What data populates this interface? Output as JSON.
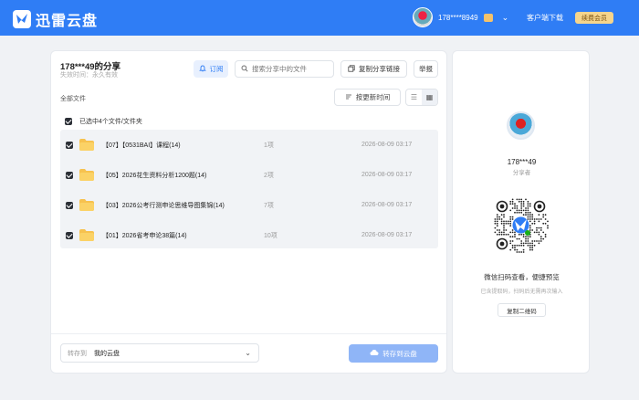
{
  "header": {
    "brand_name": "迅雷云盘",
    "user_name": "178****8949",
    "client_download": "客户端下载",
    "vip_button": "续费会员"
  },
  "share": {
    "title": "178***49的分享",
    "expiry": "失效时间：永久有效",
    "subscribe_label": "订阅",
    "search_placeholder": "搜索分享中的文件",
    "copy_link_label": "复制分享链接",
    "report_label": "举报",
    "breadcrumb": "全部文件",
    "sort_label": "按更新时间",
    "selected_text": "已选中4个文件/文件夹"
  },
  "files": [
    {
      "name": "【07】【0531BAI】课程(14)",
      "count": "1项",
      "time": "2026-08-09 03:17"
    },
    {
      "name": "【05】2026花生资料分析1200题(14)",
      "count": "2项",
      "time": "2026-08-09 03:17"
    },
    {
      "name": "【03】2026公考行测申论思维导图集锦(14)",
      "count": "7项",
      "time": "2026-08-09 03:17"
    },
    {
      "name": "【01】2026省考申论38篇(14)",
      "count": "10项",
      "time": "2026-08-09 03:17"
    }
  ],
  "footer": {
    "save_to_label": "转存到",
    "save_to_value": "我的云盘",
    "save_button": "转存到云盘"
  },
  "sharer": {
    "name": "178***49",
    "role": "分享者",
    "qr_title": "微信扫码查看，便捷预览",
    "qr_subtitle": "已含提取码，扫码后无需再次输入",
    "copy_qr_label": "复制二维码"
  },
  "colors": {
    "accent": "#2f7df5",
    "folder": "#f7c24f",
    "vip": "#f6d58c"
  }
}
